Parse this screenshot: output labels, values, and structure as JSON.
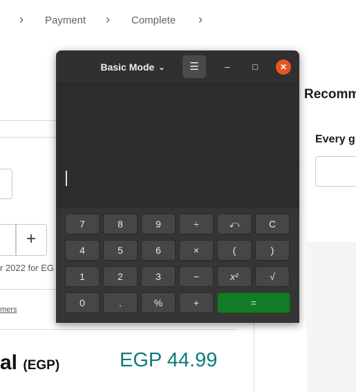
{
  "breadcrumb": {
    "items": [
      "Payment",
      "Complete"
    ],
    "separator": "›"
  },
  "webpage": {
    "recommend_heading": "Recomm",
    "every_label": "Every g",
    "quantity_plus": "+",
    "year_text": "r 2022 for EG",
    "members_link": "mers",
    "total_label": "al",
    "total_unit": "(EGP)",
    "total_price": "EGP 44.99"
  },
  "calculator": {
    "mode_label": "Basic Mode",
    "mode_chevron": "⌄",
    "menu_icon": "☰",
    "minimize_icon": "–",
    "maximize_icon": "□",
    "close_icon": "✕",
    "display_value": "",
    "keys": {
      "row1": [
        "7",
        "8",
        "9",
        "÷",
        "⤺",
        "C"
      ],
      "row2": [
        "4",
        "5",
        "6",
        "×",
        "(",
        ")"
      ],
      "row3": [
        "1",
        "2",
        "3",
        "−",
        "x²",
        "√"
      ],
      "row4": [
        "0",
        ".",
        "%",
        "+",
        "="
      ]
    },
    "colors": {
      "equals": "#127b26",
      "close": "#e95420",
      "key": "#464646"
    }
  },
  "price_color": "#0f7a7a"
}
